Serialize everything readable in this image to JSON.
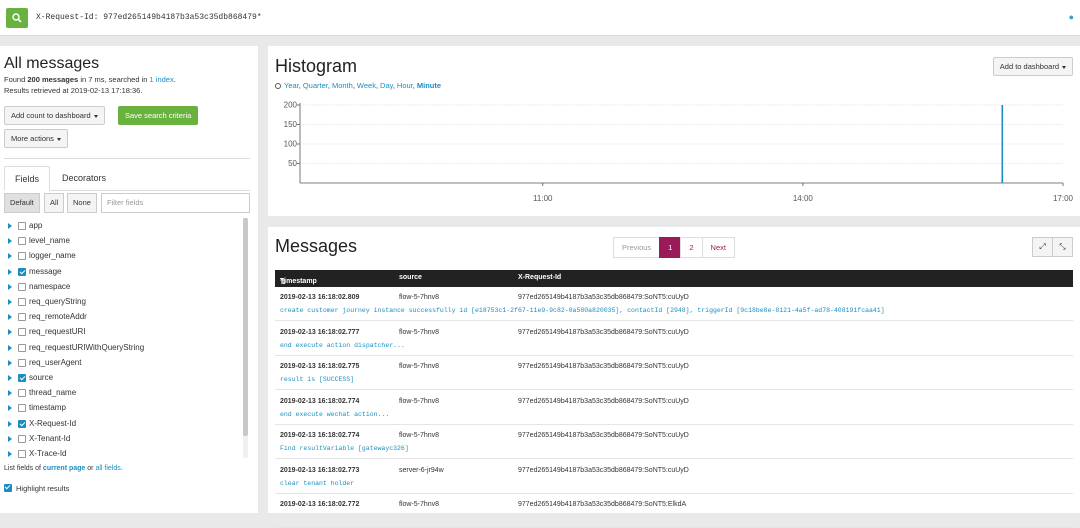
{
  "search": {
    "query": "X-Request-Id: 977ed265149b4187b3a53c35db868479*"
  },
  "sidebar": {
    "title": "All messages",
    "found_prefix": "Found ",
    "found_count": "200 messages",
    "found_mid": " in 7 ms, searched in ",
    "found_index": "1 index",
    "found_end": ".",
    "retrieved": "Results retrieved at 2019-02-13 17:18:36.",
    "add_count_label": "Add count to dashboard",
    "save_search_label": "Save search criteria",
    "more_actions_label": "More actions",
    "tabs": [
      "Fields",
      "Decorators"
    ],
    "filter_buttons": [
      "Default",
      "All",
      "None"
    ],
    "filter_placeholder": "Filter fields",
    "fields": [
      {
        "name": "app",
        "checked": false
      },
      {
        "name": "level_name",
        "checked": false
      },
      {
        "name": "logger_name",
        "checked": false
      },
      {
        "name": "message",
        "checked": true
      },
      {
        "name": "namespace",
        "checked": false
      },
      {
        "name": "req_queryString",
        "checked": false
      },
      {
        "name": "req_remoteAddr",
        "checked": false
      },
      {
        "name": "req_requestURI",
        "checked": false
      },
      {
        "name": "req_requestURIWithQueryString",
        "checked": false
      },
      {
        "name": "req_userAgent",
        "checked": false
      },
      {
        "name": "source",
        "checked": true
      },
      {
        "name": "thread_name",
        "checked": false
      },
      {
        "name": "timestamp",
        "checked": false
      },
      {
        "name": "X-Request-Id",
        "checked": true
      },
      {
        "name": "X-Tenant-Id",
        "checked": false
      },
      {
        "name": "X-Trace-Id",
        "checked": false
      }
    ],
    "list_note_prefix": "List fields of ",
    "list_note_current": "current page",
    "list_note_mid": " or ",
    "list_note_all": "all fields",
    "list_note_end": ".",
    "highlight_label": "Highlight results"
  },
  "histogram": {
    "title": "Histogram",
    "resolutions": [
      "Year",
      "Quarter",
      "Month",
      "Week",
      "Day",
      "Hour",
      "Minute"
    ],
    "active_resolution": "Minute",
    "add_dashboard_label": "Add to dashboard"
  },
  "chart_data": {
    "type": "bar",
    "ylim": [
      0,
      200
    ],
    "yticks": [
      50,
      100,
      150,
      200
    ],
    "xticks": [
      "11:00",
      "14:00",
      "17:00"
    ],
    "x_range_hours": [
      8.2,
      17.0
    ],
    "values": [
      {
        "x": "16:18",
        "y": 200
      }
    ],
    "grid": true,
    "color": "#1a8ec1"
  },
  "messages": {
    "title": "Messages",
    "pagination": {
      "previous": "Previous",
      "pages": [
        "1",
        "2"
      ],
      "active": "1",
      "next": "Next"
    },
    "expand_icon": "⤢",
    "shrink_icon": "⤡",
    "columns": [
      "Timestamp",
      "source",
      "X-Request-Id"
    ],
    "rows": [
      {
        "timestamp": "2019-02-13 16:18:02.809",
        "source": "flow-5-7hnv8",
        "request_id": "977ed265149b4187b3a53c35db868479:SoNT5:cuUyD",
        "message": "create customer journey instance successfully id [e18753c1-2f67-11e9-9c82-0a580a820035], contactId [2948], triggerId [9c18be8e-8121-4a5f-ad78-408191fcaa41]"
      },
      {
        "timestamp": "2019-02-13 16:18:02.777",
        "source": "flow-5-7hnv8",
        "request_id": "977ed265149b4187b3a53c35db868479:SoNT5:cuUyD",
        "message": "end execute action dispatcher..."
      },
      {
        "timestamp": "2019-02-13 16:18:02.775",
        "source": "flow-5-7hnv8",
        "request_id": "977ed265149b4187b3a53c35db868479:SoNT5:cuUyD",
        "message": "result is [SUCCESS]"
      },
      {
        "timestamp": "2019-02-13 16:18:02.774",
        "source": "flow-5-7hnv8",
        "request_id": "977ed265149b4187b3a53c35db868479:SoNT5:cuUyD",
        "message": "end execute wechat action..."
      },
      {
        "timestamp": "2019-02-13 16:18:02.774",
        "source": "flow-5-7hnv8",
        "request_id": "977ed265149b4187b3a53c35db868479:SoNT5:cuUyD",
        "message": "Find resultVariable [gatewayc326]"
      },
      {
        "timestamp": "2019-02-13 16:18:02.773",
        "source": "server-6-jr94w",
        "request_id": "977ed265149b4187b3a53c35db868479:SoNT5:cuUyD",
        "message": "clear tenant holder"
      },
      {
        "timestamp": "2019-02-13 16:18:02.772",
        "source": "flow-5-7hnv8",
        "request_id": "977ed265149b4187b3a53c35db868479:SoNT5:ElkdA",
        "message": ""
      }
    ]
  }
}
